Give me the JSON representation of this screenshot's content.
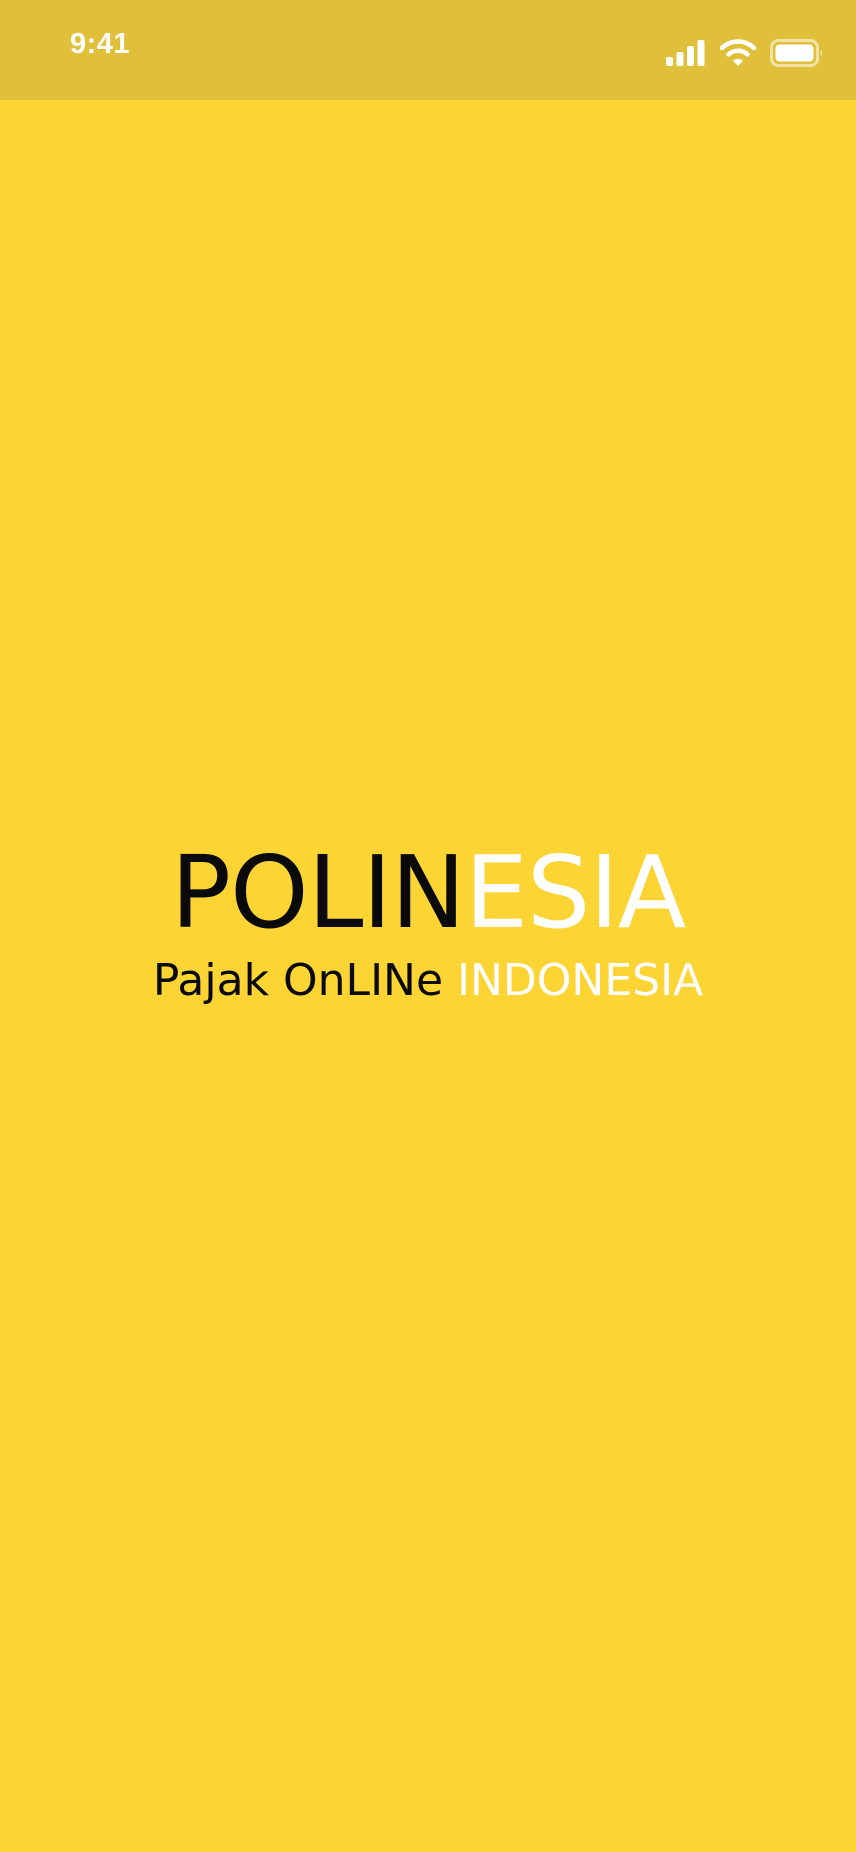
{
  "status_bar": {
    "time": "9:41",
    "icons": [
      "cellular-signal-icon",
      "wifi-icon",
      "battery-icon"
    ]
  },
  "splash": {
    "logo": {
      "part_dark": "POLIN",
      "part_light": "ESIA"
    },
    "tagline": {
      "part_dark": "Pajak OnLINe ",
      "part_light": "INDONESIA"
    }
  },
  "colors": {
    "background": "#FCD535",
    "status_bar": "#E0C03A",
    "dark_text": "#0A0A0A",
    "light_text": "#FFFFFF"
  }
}
